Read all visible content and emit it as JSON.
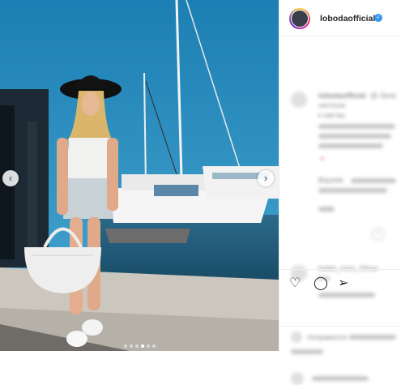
{
  "post": {
    "username": "lobodaofficial",
    "verified_icon": "verified-badge-icon",
    "caption_blurred": "lobodaofficial",
    "caption_lines": [
      "@ Зеле",
      "нечтоле",
      "к как вы"
    ],
    "comment1_text": "Bayada",
    "comment2_user": "babbi_miss_Sthas",
    "comment2_text": "отв",
    "likes_text": "понравился",
    "slide_count": 6,
    "active_slide": 3
  },
  "icons": {
    "left": "chevron-left-icon",
    "right": "chevron-right-icon",
    "like": "heart-icon",
    "comment": "comment-icon",
    "share": "share-icon"
  },
  "colors": {
    "sky": "#2a8fbf",
    "accent": "#3897f0",
    "text": "#262626"
  }
}
